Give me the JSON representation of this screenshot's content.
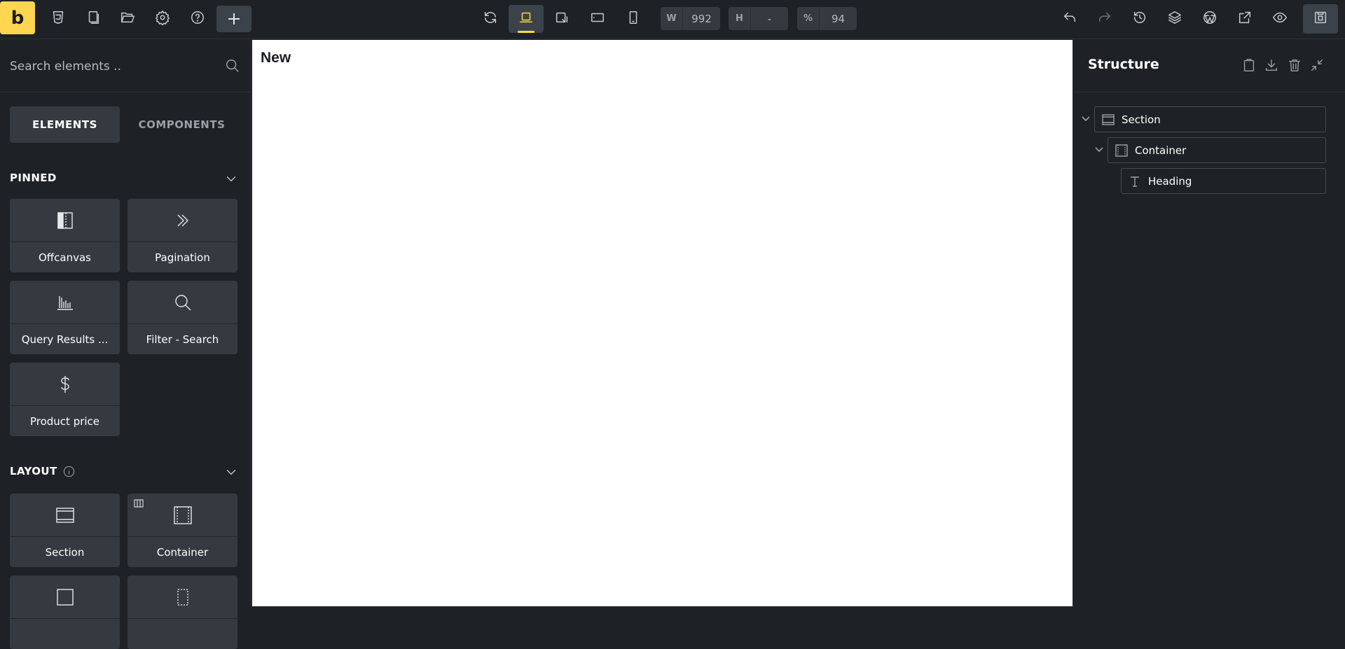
{
  "topbar": {
    "logo": "b",
    "width": {
      "label": "W",
      "value": "992"
    },
    "height": {
      "label": "H",
      "value": "-"
    },
    "zoom": {
      "label": "%",
      "value": "94"
    }
  },
  "left_panel": {
    "search_placeholder": "Search elements ..",
    "tabs": [
      {
        "label": "ELEMENTS",
        "active": true
      },
      {
        "label": "COMPONENTS",
        "active": false
      }
    ],
    "pinned": {
      "title": "PINNED",
      "items": [
        {
          "label": "Offcanvas",
          "icon": "offcanvas-icon"
        },
        {
          "label": "Pagination",
          "icon": "double-chevron-right-icon"
        },
        {
          "label": "Query Results ...",
          "icon": "bar-chart-icon"
        },
        {
          "label": "Filter - Search",
          "icon": "search-icon"
        },
        {
          "label": "Product price",
          "icon": "dollar-icon"
        }
      ]
    },
    "layout": {
      "title": "LAYOUT",
      "items": [
        {
          "label": "Section",
          "icon": "section-icon"
        },
        {
          "label": "Container",
          "icon": "container-icon"
        },
        {
          "label": "",
          "icon": "block-icon"
        },
        {
          "label": "",
          "icon": "div-icon"
        }
      ]
    }
  },
  "canvas": {
    "heading": "New"
  },
  "structure": {
    "title": "Structure",
    "nodes": [
      {
        "label": "Section",
        "icon": "section-icon",
        "level": 0
      },
      {
        "label": "Container",
        "icon": "container-icon",
        "level": 1
      },
      {
        "label": "Heading",
        "icon": "text-icon",
        "level": 2
      }
    ]
  },
  "colors": {
    "accent": "#ffd64f",
    "panel_bg": "#1e2226",
    "card_bg": "#343a40"
  }
}
